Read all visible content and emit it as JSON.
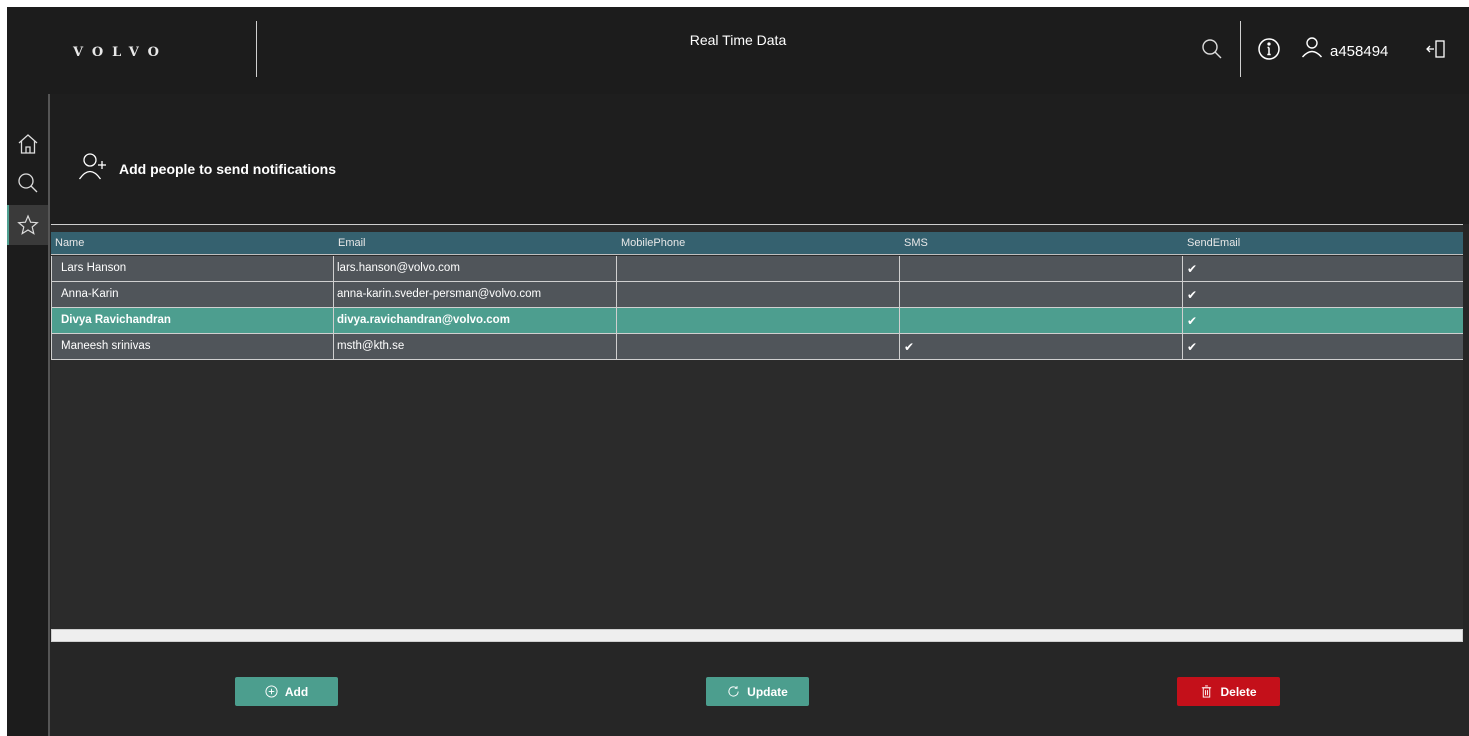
{
  "header": {
    "logo_text": "VOLVO",
    "title": "Real Time Data",
    "username": "a458494",
    "icons": [
      "search-icon",
      "info-icon",
      "user-icon",
      "logout-icon"
    ]
  },
  "sidebar": {
    "items": [
      {
        "icon": "home-icon",
        "active": false
      },
      {
        "icon": "search-icon",
        "active": false
      },
      {
        "icon": "star-icon",
        "active": true
      }
    ]
  },
  "page": {
    "title": "Add people to send notifications",
    "title_icon": "add-person-icon"
  },
  "grid": {
    "columns": [
      "Name",
      "Email",
      "MobilePhone",
      "SMS",
      "SendEmail"
    ],
    "rows": [
      {
        "name": "Lars Hanson",
        "email": "lars.hanson@volvo.com",
        "mobile": "",
        "sms": "",
        "send_email": "✔",
        "selected": false
      },
      {
        "name": "Anna-Karin",
        "email": "anna-karin.sveder-persman@volvo.com",
        "mobile": "",
        "sms": "",
        "send_email": "✔",
        "selected": false
      },
      {
        "name": "Divya Ravichandran",
        "email": "divya.ravichandran@volvo.com",
        "mobile": "",
        "sms": "",
        "send_email": "✔",
        "selected": true
      },
      {
        "name": "Maneesh srinivas",
        "email": "msth@kth.se",
        "mobile": "",
        "sms": "✔",
        "send_email": "✔",
        "selected": false
      }
    ]
  },
  "buttons": {
    "add_label": "Add",
    "update_label": "Update",
    "delete_label": "Delete"
  },
  "colors": {
    "accent": "#4c9e8e",
    "header_row": "#35616f",
    "danger": "#c4101a",
    "background": "#1c1c1c"
  }
}
